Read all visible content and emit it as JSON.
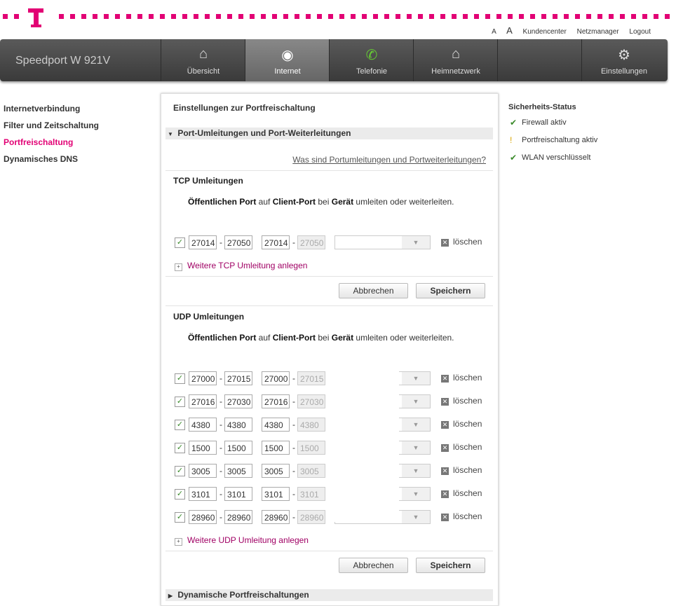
{
  "header": {
    "links": [
      "A",
      "A",
      "Kundencenter",
      "Netzmanager",
      "Logout"
    ]
  },
  "nav": {
    "brand": "Speedport W 921V",
    "tabs": [
      {
        "label": "Übersicht",
        "icon": "home-icon"
      },
      {
        "label": "Internet",
        "icon": "globe-icon"
      },
      {
        "label": "Telefonie",
        "icon": "phone-icon"
      },
      {
        "label": "Heimnetzwerk",
        "icon": "network-icon"
      },
      {
        "label": "",
        "icon": ""
      },
      {
        "label": "Einstellungen",
        "icon": "gear-icon"
      }
    ],
    "active": "Internet"
  },
  "sidebar": {
    "items": [
      {
        "label": "Internetverbindung"
      },
      {
        "label": "Filter und Zeitschaltung"
      },
      {
        "label": "Portfreischaltung",
        "active": true
      },
      {
        "label": "Dynamisches DNS"
      }
    ]
  },
  "main": {
    "title": "Einstellungen zur Portfreischaltung",
    "section1": "Port-Umleitungen und Port-Weiterleitungen",
    "help_link": "Was sind Portumleitungen und Portweiterleitungen?",
    "tcp_title": "TCP Umleitungen",
    "desc_parts": [
      "Öffentlichen Port",
      " auf ",
      "Client-Port",
      " bei ",
      "Gerät",
      " umleiten oder weiterleiten."
    ],
    "tcp_rows": [
      {
        "from1": "27014",
        "to1": "27050",
        "from2": "27014",
        "to2": "27050"
      }
    ],
    "add_tcp": "Weitere TCP Umleitung anlegen",
    "cancel": "Abbrechen",
    "save": "Speichern",
    "udp_title": "UDP Umleitungen",
    "udp_rows": [
      {
        "from1": "27000",
        "to1": "27015",
        "from2": "27000",
        "to2": "27015"
      },
      {
        "from1": "27016",
        "to1": "27030",
        "from2": "27016",
        "to2": "27030"
      },
      {
        "from1": "4380",
        "to1": "4380",
        "from2": "4380",
        "to2": "4380"
      },
      {
        "from1": "1500",
        "to1": "1500",
        "from2": "1500",
        "to2": "1500"
      },
      {
        "from1": "3005",
        "to1": "3005",
        "from2": "3005",
        "to2": "3005"
      },
      {
        "from1": "3101",
        "to1": "3101",
        "from2": "3101",
        "to2": "3101"
      },
      {
        "from1": "28960",
        "to1": "28960",
        "from2": "28960",
        "to2": "28960"
      }
    ],
    "add_udp": "Weitere UDP Umleitung anlegen",
    "delete": "löschen",
    "section2": "Dynamische Portfreischaltungen"
  },
  "status": {
    "title": "Sicherheits-Status",
    "items": [
      {
        "label": "Firewall aktiv",
        "icon": "check-icon"
      },
      {
        "label": "Portfreischaltung aktiv",
        "icon": "warning-icon"
      },
      {
        "label": "WLAN verschlüsselt",
        "icon": "check-icon"
      }
    ]
  },
  "colors": {
    "brand": "#e20074",
    "nav_bg": "#4a4a4a"
  }
}
